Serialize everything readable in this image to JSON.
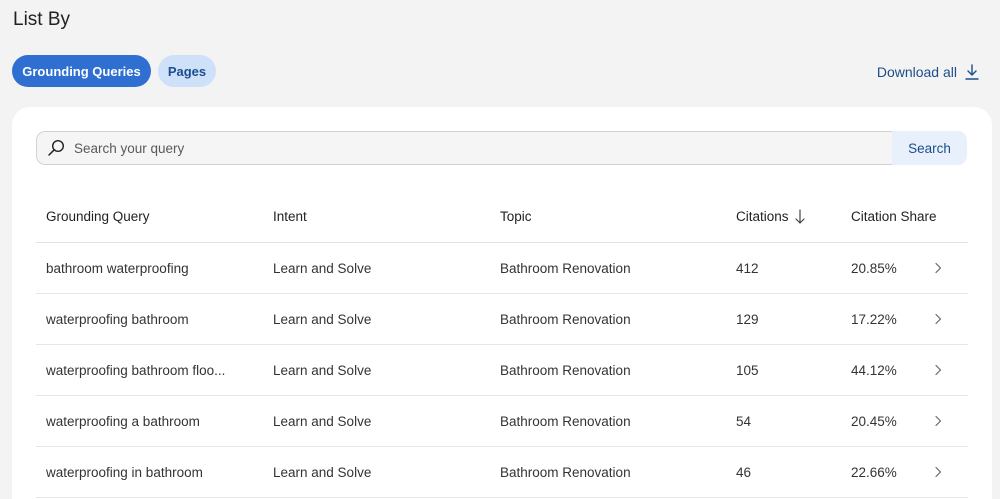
{
  "header": {
    "title": "List By"
  },
  "tabs": [
    {
      "label": "Grounding Queries",
      "active": true
    },
    {
      "label": "Pages",
      "active": false
    }
  ],
  "download": {
    "label": "Download all",
    "icon": "download-icon"
  },
  "search": {
    "placeholder": "Search your query",
    "value": "",
    "button_label": "Search"
  },
  "table": {
    "columns": [
      "Grounding Query",
      "Intent",
      "Topic",
      "Citations",
      "Citation Share"
    ],
    "sort_column": "Citations",
    "sort_direction": "descending",
    "rows": [
      {
        "query": "bathroom waterproofing",
        "intent": "Learn and Solve",
        "topic": "Bathroom Renovation",
        "citations": "412",
        "share": "20.85%"
      },
      {
        "query": "waterproofing bathroom",
        "intent": "Learn and Solve",
        "topic": "Bathroom Renovation",
        "citations": "129",
        "share": "17.22%"
      },
      {
        "query": "waterproofing bathroom floo...",
        "intent": "Learn and Solve",
        "topic": "Bathroom Renovation",
        "citations": "105",
        "share": "44.12%"
      },
      {
        "query": "waterproofing a bathroom",
        "intent": "Learn and Solve",
        "topic": "Bathroom Renovation",
        "citations": "54",
        "share": "20.45%"
      },
      {
        "query": "waterproofing in bathroom",
        "intent": "Learn and Solve",
        "topic": "Bathroom Renovation",
        "citations": "46",
        "share": "22.66%"
      }
    ]
  },
  "colors": {
    "accent": "#2f6fd1",
    "tab_inactive_bg": "#cfe1f8",
    "link": "#1d4e89"
  }
}
